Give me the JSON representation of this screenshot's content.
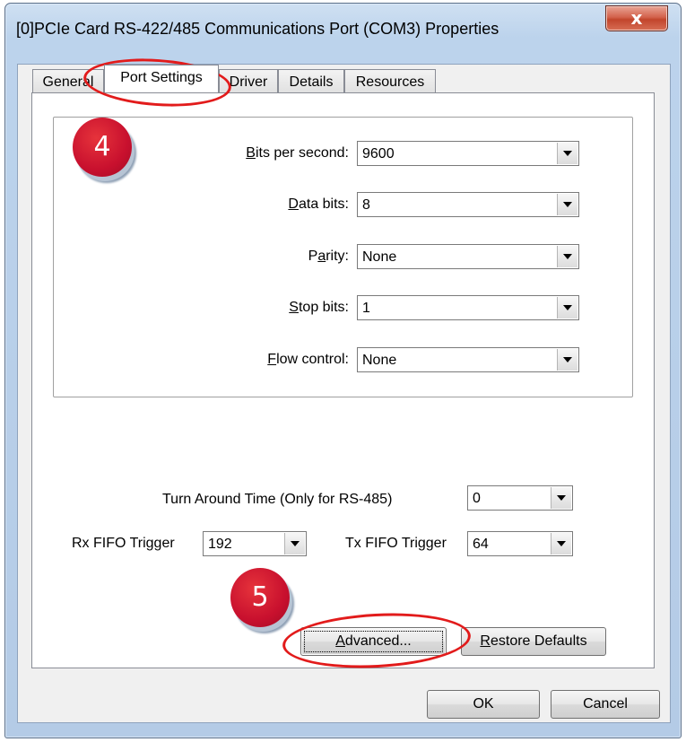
{
  "window": {
    "title": "[0]PCIe Card RS-422/485 Communications Port (COM3) Properties",
    "close_glyph": "x"
  },
  "tabs": [
    {
      "label": "General"
    },
    {
      "label": "Port Settings"
    },
    {
      "label": "Driver"
    },
    {
      "label": "Details"
    },
    {
      "label": "Resources"
    }
  ],
  "settings": {
    "bits_per_second": {
      "label_key": "B",
      "label_rest": "its per second:",
      "value": "9600"
    },
    "data_bits": {
      "label_key": "D",
      "label_rest": "ata bits:",
      "value": "8"
    },
    "parity": {
      "label_pre": "P",
      "label_key": "a",
      "label_rest": "rity:",
      "value": "None"
    },
    "stop_bits": {
      "label_key": "S",
      "label_rest": "top bits:",
      "value": "1"
    },
    "flow_control": {
      "label_key": "F",
      "label_rest": "low control:",
      "value": "None"
    }
  },
  "advanced": {
    "turn_around_label": "Turn Around Time (Only for RS-485)",
    "turn_around_value": "0",
    "rx_fifo_label": "Rx FIFO Trigger",
    "rx_fifo_value": "192",
    "tx_fifo_label": "Tx FIFO Trigger",
    "tx_fifo_value": "64"
  },
  "buttons": {
    "advanced_key": "A",
    "advanced_rest": "dvanced...",
    "restore_key": "R",
    "restore_rest": "estore Defaults",
    "ok": "OK",
    "cancel": "Cancel"
  },
  "annotations": {
    "step4": "4",
    "step5": "5",
    "highlight_color": "#e21b1b",
    "badge_color": "#c8102e"
  }
}
